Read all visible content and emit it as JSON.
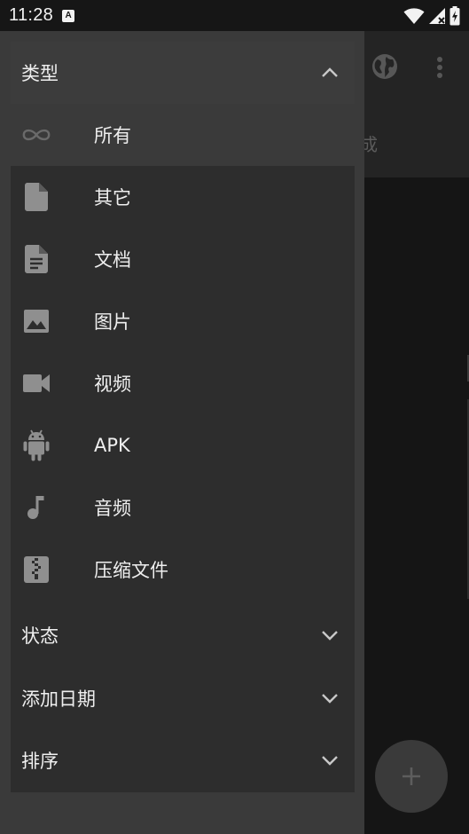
{
  "status_bar": {
    "time": "11:28",
    "notification_letter": "A",
    "icons": [
      "notification-a-icon",
      "wifi-icon",
      "signal-icon",
      "battery-charging-icon"
    ]
  },
  "background_app": {
    "tab_text_partial": "成",
    "toolbar_icons": [
      "globe-icon",
      "more-vert-icon"
    ],
    "fab_icon": "plus-icon"
  },
  "drawer": {
    "type_section": {
      "title": "类型",
      "expanded": true,
      "items": [
        {
          "label": "所有",
          "icon": "infinity-icon",
          "selected": true
        },
        {
          "label": "其它",
          "icon": "file-icon",
          "selected": false
        },
        {
          "label": "文档",
          "icon": "document-icon",
          "selected": false
        },
        {
          "label": "图片",
          "icon": "image-icon",
          "selected": false
        },
        {
          "label": "视频",
          "icon": "video-icon",
          "selected": false
        },
        {
          "label": "APK",
          "icon": "android-icon",
          "selected": false
        },
        {
          "label": "音频",
          "icon": "music-note-icon",
          "selected": false
        },
        {
          "label": "压缩文件",
          "icon": "archive-icon",
          "selected": false
        }
      ]
    },
    "status_section": {
      "title": "状态",
      "expanded": false
    },
    "date_section": {
      "title": "添加日期",
      "expanded": false
    },
    "sort_section": {
      "title": "排序",
      "expanded": false
    }
  },
  "colors": {
    "drawer_bg": "#3a3a3a",
    "panel_bg": "#2d2d2d",
    "icon_gray": "#8f8f8f",
    "text": "#efefef"
  }
}
